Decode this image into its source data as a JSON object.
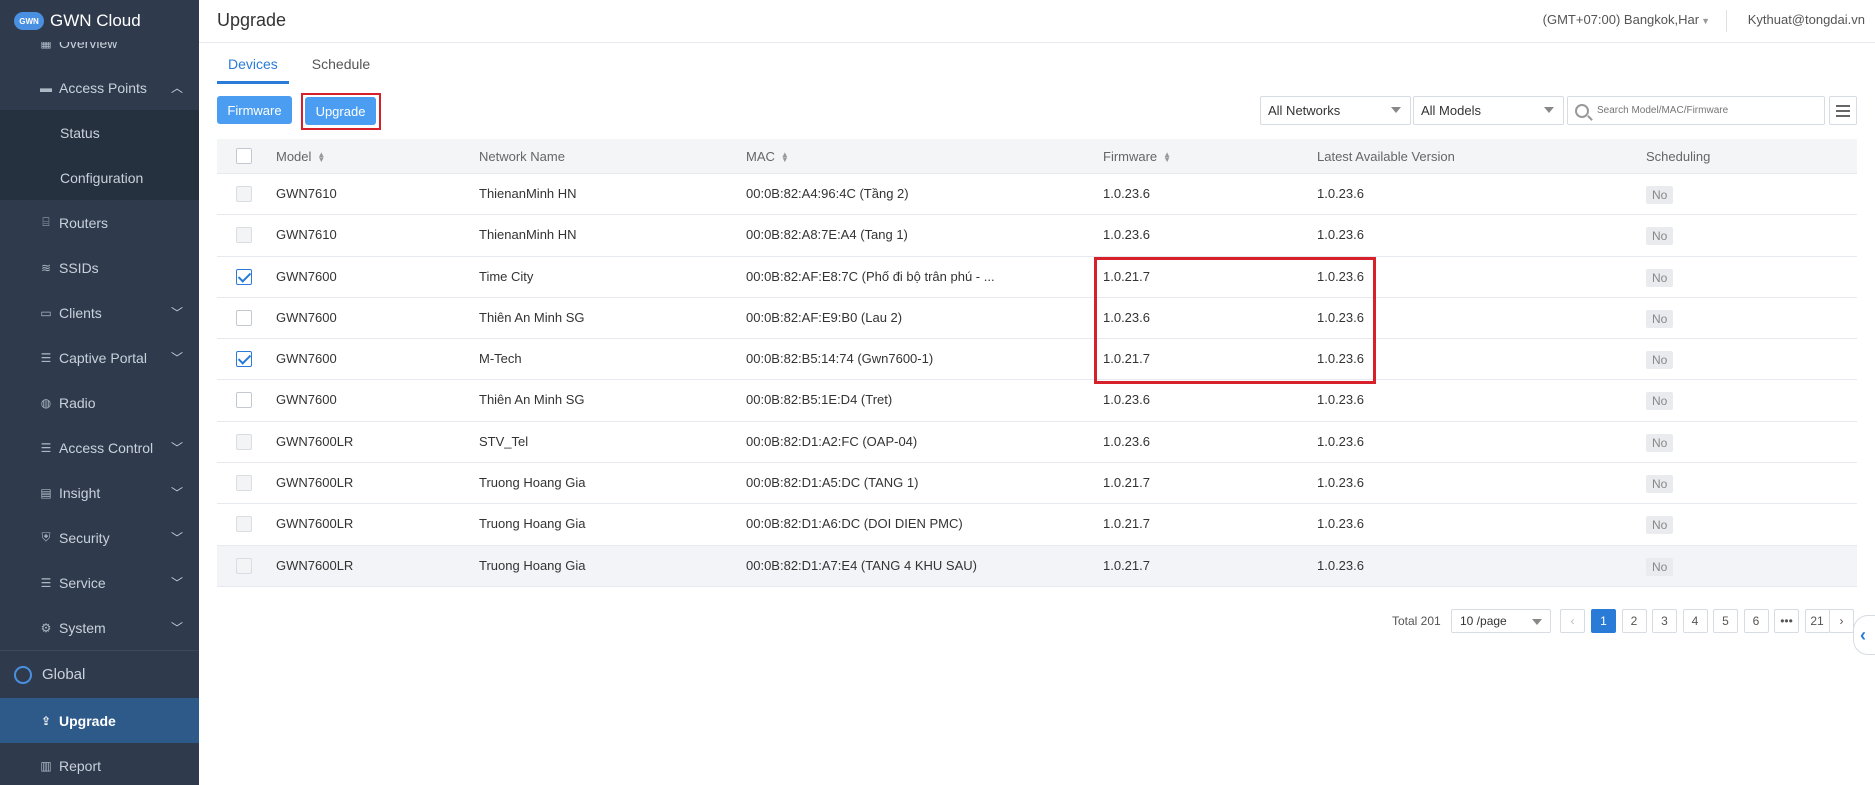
{
  "app": {
    "name": "GWN Cloud",
    "logo_text": "GWN"
  },
  "sidebar": {
    "items": [
      {
        "label": "Overview",
        "icon": "overview-icon"
      },
      {
        "label": "Access Points",
        "icon": "access-point-icon",
        "expanded": true
      },
      {
        "label": "Status"
      },
      {
        "label": "Configuration"
      },
      {
        "label": "Routers",
        "icon": "router-icon"
      },
      {
        "label": "SSIDs",
        "icon": "wifi-icon"
      },
      {
        "label": "Clients",
        "icon": "clients-icon"
      },
      {
        "label": "Captive Portal",
        "icon": "list-icon"
      },
      {
        "label": "Radio",
        "icon": "radio-icon"
      },
      {
        "label": "Access Control",
        "icon": "list-icon"
      },
      {
        "label": "Insight",
        "icon": "insight-icon"
      },
      {
        "label": "Security",
        "icon": "shield-icon"
      },
      {
        "label": "Service",
        "icon": "list-icon"
      },
      {
        "label": "System",
        "icon": "gear-icon"
      }
    ],
    "global_label": "Global",
    "upgrade_label": "Upgrade",
    "report_label": "Report"
  },
  "header": {
    "title": "Upgrade",
    "timezone": "(GMT+07:00) Bangkok,Har",
    "user": "Kythuat@tongdai.vn"
  },
  "tabs": [
    {
      "label": "Devices",
      "active": true
    },
    {
      "label": "Schedule",
      "active": false
    }
  ],
  "toolbar": {
    "firmware_label": "Firmware",
    "upgrade_label": "Upgrade",
    "networks_value": "All Networks",
    "models_value": "All Models",
    "search_placeholder": "Search Model/MAC/Firmware"
  },
  "table": {
    "columns": [
      "Model",
      "Network Name",
      "MAC",
      "Firmware",
      "Latest Available Version",
      "Scheduling"
    ],
    "rows": [
      {
        "checked": false,
        "disabled": true,
        "model": "GWN7610",
        "network": "ThienanMinh HN",
        "mac": "00:0B:82:A4:96:4C (Tầng 2)",
        "firmware": "1.0.23.6",
        "latest": "1.0.23.6",
        "scheduling": "No"
      },
      {
        "checked": false,
        "disabled": true,
        "model": "GWN7610",
        "network": "ThienanMinh HN",
        "mac": "00:0B:82:A8:7E:A4 (Tang 1)",
        "firmware": "1.0.23.6",
        "latest": "1.0.23.6",
        "scheduling": "No"
      },
      {
        "checked": true,
        "disabled": false,
        "model": "GWN7600",
        "network": "Time City",
        "mac": "00:0B:82:AF:E8:7C (Phố đi bộ trân phú - ...",
        "firmware": "1.0.21.7",
        "latest": "1.0.23.6",
        "scheduling": "No"
      },
      {
        "checked": false,
        "disabled": false,
        "model": "GWN7600",
        "network": "Thiên An Minh SG",
        "mac": "00:0B:82:AF:E9:B0 (Lau 2)",
        "firmware": "1.0.23.6",
        "latest": "1.0.23.6",
        "scheduling": "No"
      },
      {
        "checked": true,
        "disabled": false,
        "model": "GWN7600",
        "network": "M-Tech",
        "mac": "00:0B:82:B5:14:74 (Gwn7600-1)",
        "firmware": "1.0.21.7",
        "latest": "1.0.23.6",
        "scheduling": "No"
      },
      {
        "checked": false,
        "disabled": false,
        "model": "GWN7600",
        "network": "Thiên An Minh SG",
        "mac": "00:0B:82:B5:1E:D4 (Tret)",
        "firmware": "1.0.23.6",
        "latest": "1.0.23.6",
        "scheduling": "No"
      },
      {
        "checked": false,
        "disabled": true,
        "model": "GWN7600LR",
        "network": "STV_Tel",
        "mac": "00:0B:82:D1:A2:FC (OAP-04)",
        "firmware": "1.0.23.6",
        "latest": "1.0.23.6",
        "scheduling": "No"
      },
      {
        "checked": false,
        "disabled": true,
        "model": "GWN7600LR",
        "network": "Truong Hoang Gia",
        "mac": "00:0B:82:D1:A5:DC (TANG 1)",
        "firmware": "1.0.21.7",
        "latest": "1.0.23.6",
        "scheduling": "No"
      },
      {
        "checked": false,
        "disabled": true,
        "model": "GWN7600LR",
        "network": "Truong Hoang Gia",
        "mac": "00:0B:82:D1:A6:DC (DOI DIEN PMC)",
        "firmware": "1.0.21.7",
        "latest": "1.0.23.6",
        "scheduling": "No"
      },
      {
        "checked": false,
        "disabled": true,
        "model": "GWN7600LR",
        "network": "Truong Hoang Gia",
        "mac": "00:0B:82:D1:A7:E4 (TANG 4 KHU SAU)",
        "firmware": "1.0.21.7",
        "latest": "1.0.23.6",
        "scheduling": "No"
      }
    ]
  },
  "pagination": {
    "total": "Total 201",
    "page_size": "10 /page",
    "pages": [
      "1",
      "2",
      "3",
      "4",
      "5",
      "6",
      "•••",
      "21"
    ],
    "prev": "‹",
    "next": "›"
  },
  "colors": {
    "accent": "#2a7bd8",
    "button": "#4a9df0",
    "highlight": "#d6202a",
    "sidebar": "#2f3b4c"
  }
}
